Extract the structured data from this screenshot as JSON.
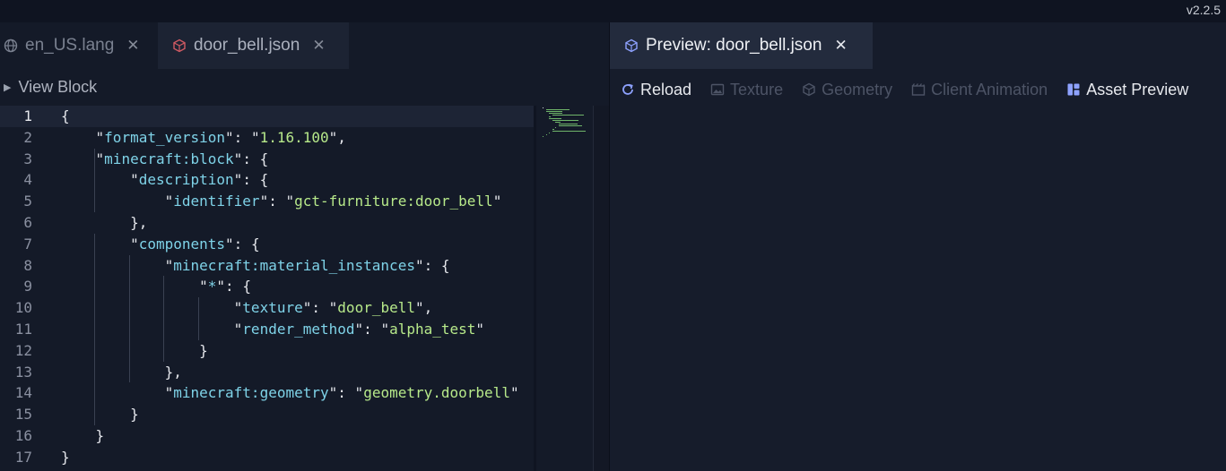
{
  "app": {
    "version": "v2.2.5"
  },
  "left_tabs": [
    {
      "label": "en_US.lang",
      "icon": "globe-icon"
    },
    {
      "label": "door_bell.json",
      "icon": "cube-icon"
    }
  ],
  "right_tabs": [
    {
      "label": "Preview: door_bell.json",
      "icon": "cube-icon"
    }
  ],
  "view_block": {
    "label": "View Block"
  },
  "preview_toolbar": {
    "reload": "Reload",
    "texture": "Texture",
    "geometry": "Geometry",
    "client_animation": "Client Animation",
    "asset_preview": "Asset Preview"
  },
  "editor": {
    "current_line": 1,
    "line_numbers": [
      "1",
      "2",
      "3",
      "4",
      "5",
      "6",
      "7",
      "8",
      "9",
      "10",
      "11",
      "12",
      "13",
      "14",
      "15",
      "16",
      "17"
    ],
    "lines": [
      "{",
      "    \"format_version\": \"1.16.100\",",
      "    \"minecraft:block\": {",
      "        \"description\": {",
      "            \"identifier\": \"gct-furniture:door_bell\"",
      "        },",
      "        \"components\": {",
      "            \"minecraft:material_instances\": {",
      "                \"*\": {",
      "                    \"texture\": \"door_bell\",",
      "                    \"render_method\": \"alpha_test\"",
      "                }",
      "            },",
      "            \"minecraft:geometry\": \"geometry.doorbell\"",
      "        }",
      "    }",
      "}"
    ]
  },
  "colors": {
    "background": "#141a28",
    "json_key": "#7fd3e8",
    "json_string": "#b7e98a",
    "punctuation": "#e4e6eb",
    "line_number": "#8a90a0"
  }
}
